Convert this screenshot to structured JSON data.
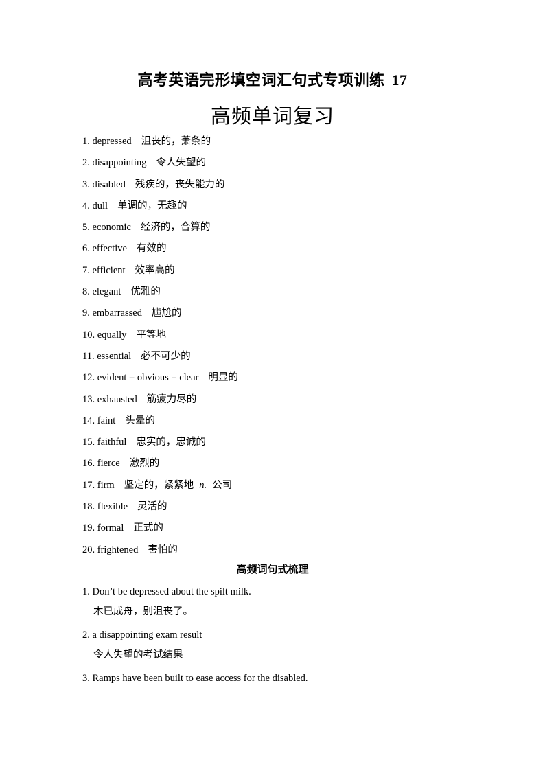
{
  "document": {
    "title": "高考英语完形填空词汇句式专项训练",
    "title_number": "17",
    "section_title": "高频单词复习",
    "vocabulary": [
      {
        "index": "1.",
        "word": "depressed",
        "meaning": "沮丧的，萧条的"
      },
      {
        "index": "2.",
        "word": "disappointing",
        "meaning": "令人失望的"
      },
      {
        "index": "3.",
        "word": "disabled",
        "meaning": "残疾的，丧失能力的"
      },
      {
        "index": "4.",
        "word": "dull",
        "meaning": "单调的，无趣的"
      },
      {
        "index": "5.",
        "word": "economic",
        "meaning": "经济的，合算的"
      },
      {
        "index": "6.",
        "word": "effective",
        "meaning": "有效的"
      },
      {
        "index": "7.",
        "word": "efficient",
        "meaning": "效率高的"
      },
      {
        "index": "8.",
        "word": "elegant",
        "meaning": "优雅的"
      },
      {
        "index": "9.",
        "word": "embarrassed",
        "meaning": "尴尬的"
      },
      {
        "index": "10.",
        "word": "equally",
        "meaning": "平等地"
      },
      {
        "index": "11.",
        "word": "essential",
        "meaning": "必不可少的"
      },
      {
        "index": "12.",
        "word": "evident = obvious = clear",
        "meaning": "明显的"
      },
      {
        "index": "13.",
        "word": "exhausted",
        "meaning": "筋疲力尽的"
      },
      {
        "index": "14.",
        "word": "faint",
        "meaning": "头晕的"
      },
      {
        "index": "15.",
        "word": "faithful",
        "meaning": "忠实的，忠诚的"
      },
      {
        "index": "16.",
        "word": "fierce",
        "meaning": "激烈的"
      },
      {
        "index": "17.",
        "word": "firm",
        "meaning": "坚定的，紧紧地",
        "pos": "n.",
        "extra_meaning": "公司"
      },
      {
        "index": "18.",
        "word": "flexible",
        "meaning": "灵活的"
      },
      {
        "index": "19.",
        "word": "formal",
        "meaning": "正式的"
      },
      {
        "index": "20.",
        "word": "frightened",
        "meaning": "害怕的"
      }
    ],
    "subsection_title": "高频词句式梳理",
    "sentences": [
      {
        "index": "1.",
        "english": "Don’t be depressed about the spilt milk.",
        "chinese": "木已成舟，别沮丧了。"
      },
      {
        "index": "2.",
        "english": "a disappointing exam result",
        "chinese": "令人失望的考试结果"
      },
      {
        "index": "3.",
        "english": "Ramps have been built to ease access for the disabled.",
        "chinese": ""
      }
    ]
  }
}
